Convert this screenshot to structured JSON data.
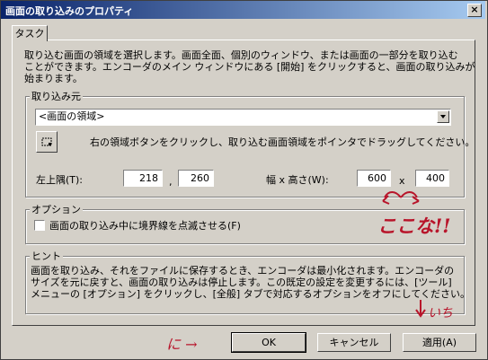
{
  "window": {
    "title": "画面の取り込みのプロパティ",
    "close_label": "×"
  },
  "tabs": [
    {
      "label": "タスク"
    }
  ],
  "description": [
    "取り込む画面の領域を選択します。画面全面、個別のウィンドウ、または画面の一部分を取り込む",
    "ことができます。エンコーダのメイン ウィンドウにある [開始] をクリックすると、画面の取り込みが",
    "始まります。"
  ],
  "source_group": {
    "legend": "取り込み元",
    "combo_value": "<画面の領域>",
    "instruction": "右の領域ボタンをクリックし、取り込む画面領域をポインタでドラッグしてください。",
    "topleft_label": "左上隅(T):",
    "x_value": "218",
    "comma": ",",
    "y_value": "260",
    "size_label": "幅 x 高さ(W):",
    "width_value": "600",
    "times": "x",
    "height_value": "400"
  },
  "option_group": {
    "legend": "オプション",
    "checkbox_label": "画面の取り込み中に境界線を点滅させる(F)",
    "checked": false
  },
  "hint_group": {
    "legend": "ヒント",
    "lines": [
      "画面を取り込み、それをファイルに保存するとき、エンコーダは最小化されます。エンコーダの",
      "サイズを元に戻すと、画面の取り込みは停止します。この既定の設定を変更するには、[ツール]",
      "メニューの [オプション] をクリックし、[全般] タブで対応するオプションをオフにしてください。"
    ]
  },
  "buttons": {
    "ok": "OK",
    "cancel": "キャンセル",
    "apply": "適用(A)"
  },
  "annotations": {
    "color": "#b8142a",
    "koko": "ここな!!",
    "ichi": "いち",
    "ni": "に →"
  }
}
